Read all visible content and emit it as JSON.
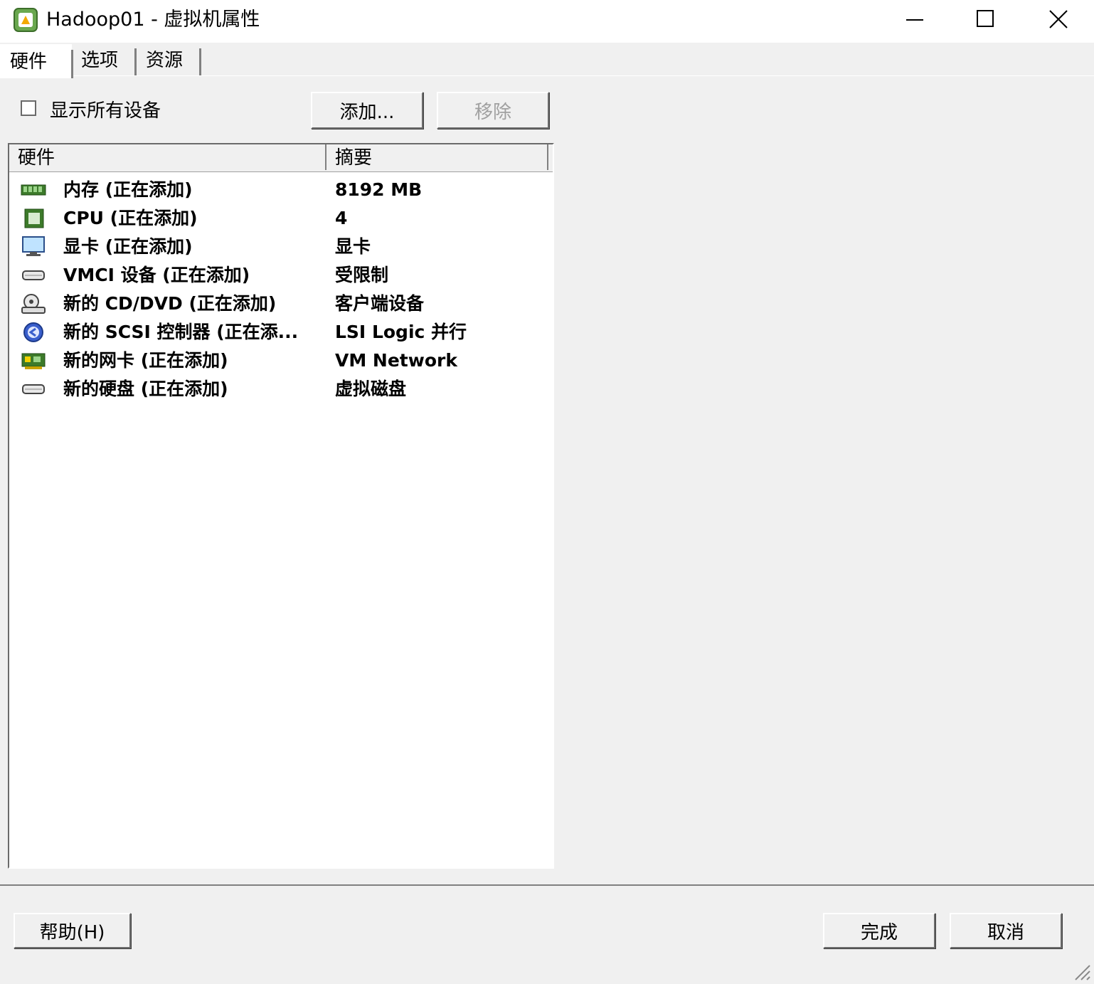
{
  "window": {
    "title": "Hadoop01 - 虚拟机属性",
    "minimize": "—",
    "maximize": "☐",
    "close": "✕"
  },
  "tabs": [
    {
      "label": "硬件",
      "active": true
    },
    {
      "label": "选项",
      "active": false
    },
    {
      "label": "资源",
      "active": false
    }
  ],
  "toolbar": {
    "show_all_label": "显示所有设备",
    "show_all_checked": false,
    "add_label": "添加...",
    "remove_label": "移除"
  },
  "table": {
    "columns": [
      "硬件",
      "摘要"
    ],
    "rows": [
      {
        "icon": "memory-icon",
        "hardware": "内存 (正在添加)",
        "summary": "8192 MB"
      },
      {
        "icon": "cpu-icon",
        "hardware": "CPU (正在添加)",
        "summary": "4"
      },
      {
        "icon": "display-icon",
        "hardware": "显卡 (正在添加)",
        "summary": "显卡"
      },
      {
        "icon": "vmci-device-icon",
        "hardware": "VMCI 设备 (正在添加)",
        "summary": "受限制"
      },
      {
        "icon": "cd-dvd-icon",
        "hardware": "新的 CD/DVD (正在添加)",
        "summary": "客户端设备"
      },
      {
        "icon": "scsi-controller-icon",
        "hardware": "新的 SCSI 控制器 (正在添...",
        "summary": "LSI Logic 并行"
      },
      {
        "icon": "network-card-icon",
        "hardware": "新的网卡 (正在添加)",
        "summary": "VM Network"
      },
      {
        "icon": "hard-disk-icon",
        "hardware": "新的硬盘 (正在添加)",
        "summary": "虚拟磁盘"
      }
    ]
  },
  "footer": {
    "help_label": "帮助(H)",
    "finish_label": "完成",
    "cancel_label": "取消"
  },
  "colors": {
    "window_bg": "#f0f0f0",
    "table_bg": "#ffffff",
    "icon_green": "#3c7a2a",
    "icon_blue": "#3a5fcd"
  }
}
